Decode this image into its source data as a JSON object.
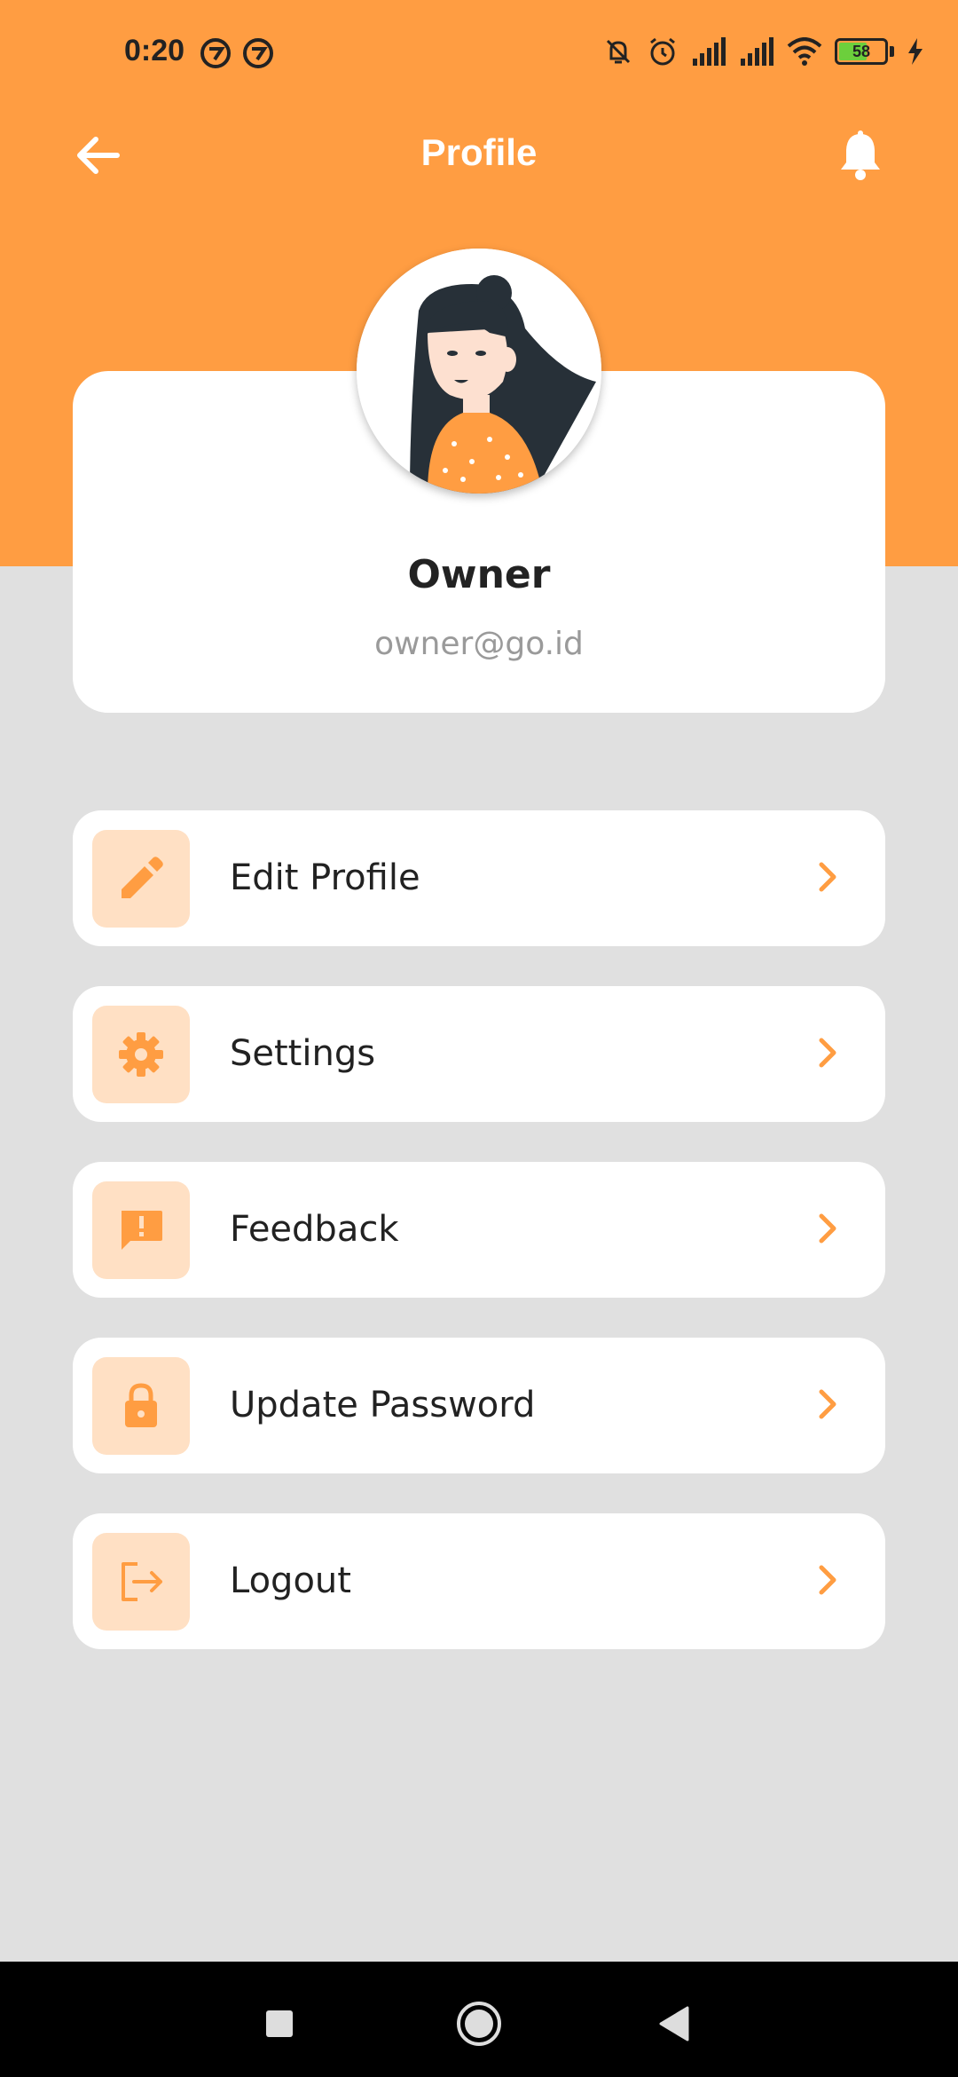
{
  "status_bar": {
    "time": "0:20",
    "battery_level": "58"
  },
  "app_bar": {
    "title": "Profile"
  },
  "profile": {
    "name": "Owner",
    "email": "owner@go.id"
  },
  "menu": [
    {
      "label": "Edit Profile",
      "icon": "pencil-icon"
    },
    {
      "label": "Settings",
      "icon": "gear-icon"
    },
    {
      "label": "Feedback",
      "icon": "feedback-icon"
    },
    {
      "label": "Update Password",
      "icon": "lock-icon"
    },
    {
      "label": "Logout",
      "icon": "logout-icon"
    }
  ],
  "colors": {
    "accent": "#ff9d42",
    "icon_bg": "#ffe0c4",
    "page_bg": "#e0e0e0"
  }
}
